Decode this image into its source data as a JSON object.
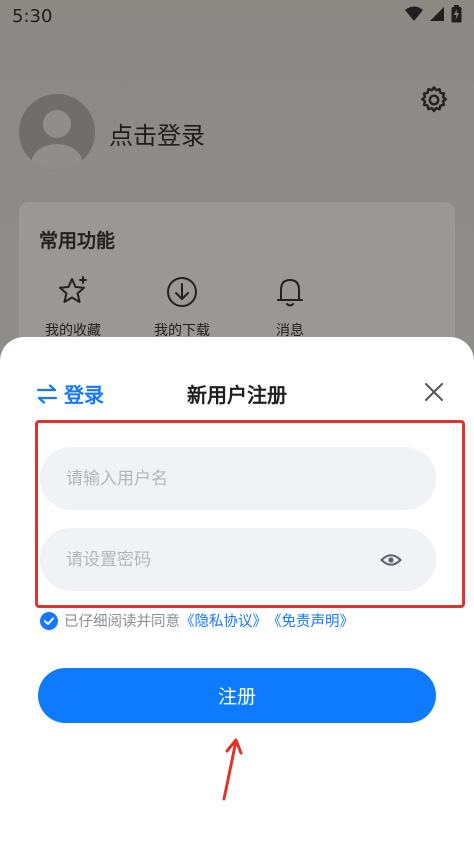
{
  "status_bar": {
    "time": "5:30"
  },
  "profile": {
    "login_prompt": "点击登录"
  },
  "functions": {
    "title": "常用功能",
    "items": [
      {
        "label": "我的收藏",
        "icon": "star-icon"
      },
      {
        "label": "我的下载",
        "icon": "download-icon"
      },
      {
        "label": "消息",
        "icon": "bell-icon"
      }
    ]
  },
  "sheet": {
    "switch_label": "登录",
    "title": "新用户注册",
    "username_placeholder": "请输入用户名",
    "password_placeholder": "请设置密码",
    "agreement": {
      "prefix": "已仔细阅读并同意",
      "privacy_link": "《隐私协议》",
      "disclaimer_link": "《免责声明》",
      "checked": true
    },
    "register_label": "注册"
  },
  "colors": {
    "accent": "#1677ff",
    "button": "#0e7bff",
    "annotation": "#e2332b"
  }
}
